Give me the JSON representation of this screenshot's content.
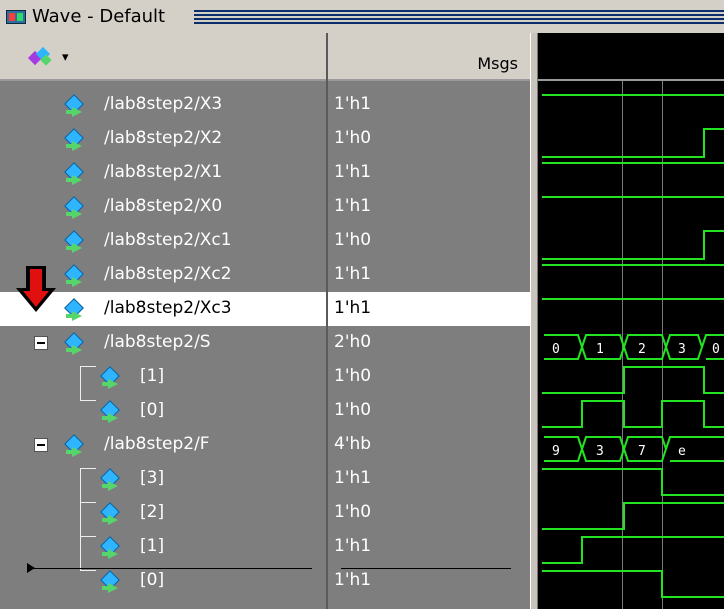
{
  "window": {
    "title": "Wave - Default"
  },
  "panes": {
    "msgs_header": "Msgs"
  },
  "signals": [
    {
      "name": "/lab8step2/X3",
      "value": "1'h1"
    },
    {
      "name": "/lab8step2/X2",
      "value": "1'h0"
    },
    {
      "name": "/lab8step2/X1",
      "value": "1'h1"
    },
    {
      "name": "/lab8step2/X0",
      "value": "1'h1"
    },
    {
      "name": "/lab8step2/Xc1",
      "value": "1'h0"
    },
    {
      "name": "/lab8step2/Xc2",
      "value": "1'h1"
    },
    {
      "name": "/lab8step2/Xc3",
      "value": "1'h1"
    },
    {
      "name": "/lab8step2/S",
      "value": "2'h0"
    },
    {
      "name": "[1]",
      "value": "1'h0"
    },
    {
      "name": "[0]",
      "value": "1'h0"
    },
    {
      "name": "/lab8step2/F",
      "value": "4'hb"
    },
    {
      "name": "[3]",
      "value": "1'h1"
    },
    {
      "name": "[2]",
      "value": "1'h0"
    },
    {
      "name": "[1]",
      "value": "1'h1"
    },
    {
      "name": "[0]",
      "value": "1'h1"
    }
  ],
  "wave_bus_labels": {
    "S": [
      "0",
      "1",
      "2",
      "3",
      "0"
    ],
    "F": [
      "9",
      "3",
      "7",
      "e"
    ]
  },
  "colors": {
    "wave_line": "#22e322",
    "selected_row": "#ffffff",
    "pane_bg": "#7e7e7e"
  },
  "icons": {
    "window": "wave-window-icon",
    "toolbar": "signal-add-icon",
    "signal": "signal-diamond-icon",
    "marker": "red-down-arrow-icon"
  }
}
